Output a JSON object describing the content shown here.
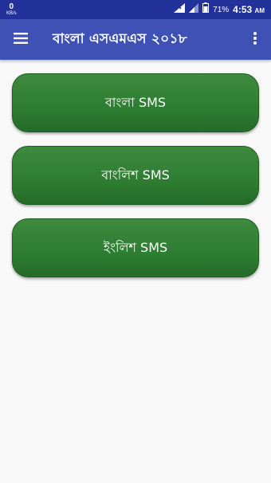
{
  "status_bar": {
    "net_speed_value": "0",
    "net_speed_unit": "KB/s",
    "battery_percent": "71%",
    "time": "4:53",
    "time_suffix": "AM"
  },
  "toolbar": {
    "title": "বাংলা এসএমএস ২০১৮",
    "menu_icon": "hamburger-menu-icon",
    "overflow_icon": "more-vert-icon"
  },
  "menu": {
    "items": [
      {
        "label": "বাংলা SMS"
      },
      {
        "label": "বাংলিশ SMS"
      },
      {
        "label": "ইংলিশ SMS"
      }
    ]
  },
  "colors": {
    "status_bar": "#23329a",
    "toolbar": "#3f51b5",
    "button": "#2e7d32",
    "background": "#f8f8f8"
  }
}
